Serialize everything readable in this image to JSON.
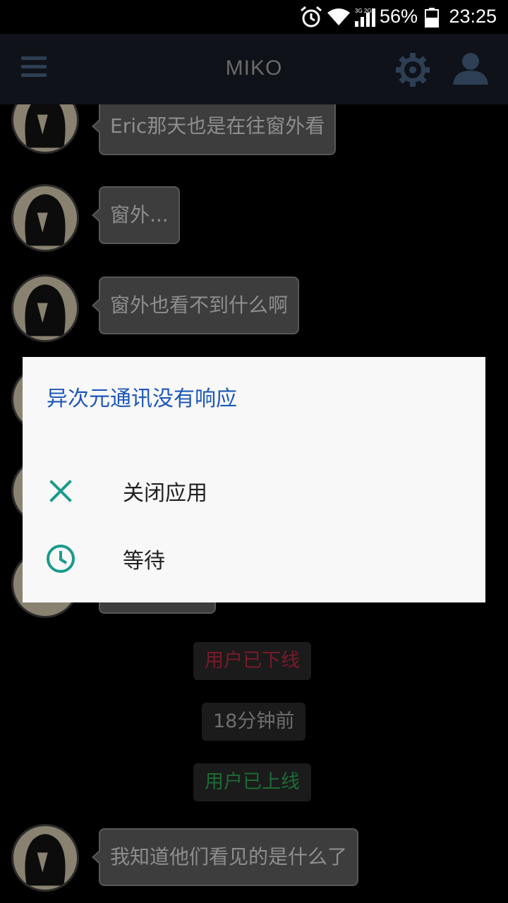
{
  "status_bar": {
    "time": "23:25",
    "battery": "56%",
    "network": "3G 2G",
    "icons": [
      "alarm-icon",
      "wifi-icon",
      "signal-icon",
      "battery-icon"
    ]
  },
  "app_bar": {
    "title": "MIKO",
    "icons": [
      "menu-icon",
      "gear-icon",
      "user-icon"
    ]
  },
  "messages": [
    {
      "text": "Eric那天也是在往窗外看"
    },
    {
      "text": "窗外..."
    },
    {
      "text": "窗外也看不到什么啊"
    },
    {
      "text": "我知道他们看见的是什么了"
    }
  ],
  "system": {
    "offline": "用户已下线",
    "time_ago": "18分钟前",
    "online": "用户已上线"
  },
  "dialog": {
    "title": "异次元通讯没有响应",
    "close_label": "关闭应用",
    "wait_label": "等待"
  },
  "colors": {
    "dialog_title": "#1e57b8",
    "dialog_icon": "#1a9a8c",
    "offline": "#7a1a2a",
    "online": "#1c6b34",
    "bubble": "#3d3d3d"
  }
}
